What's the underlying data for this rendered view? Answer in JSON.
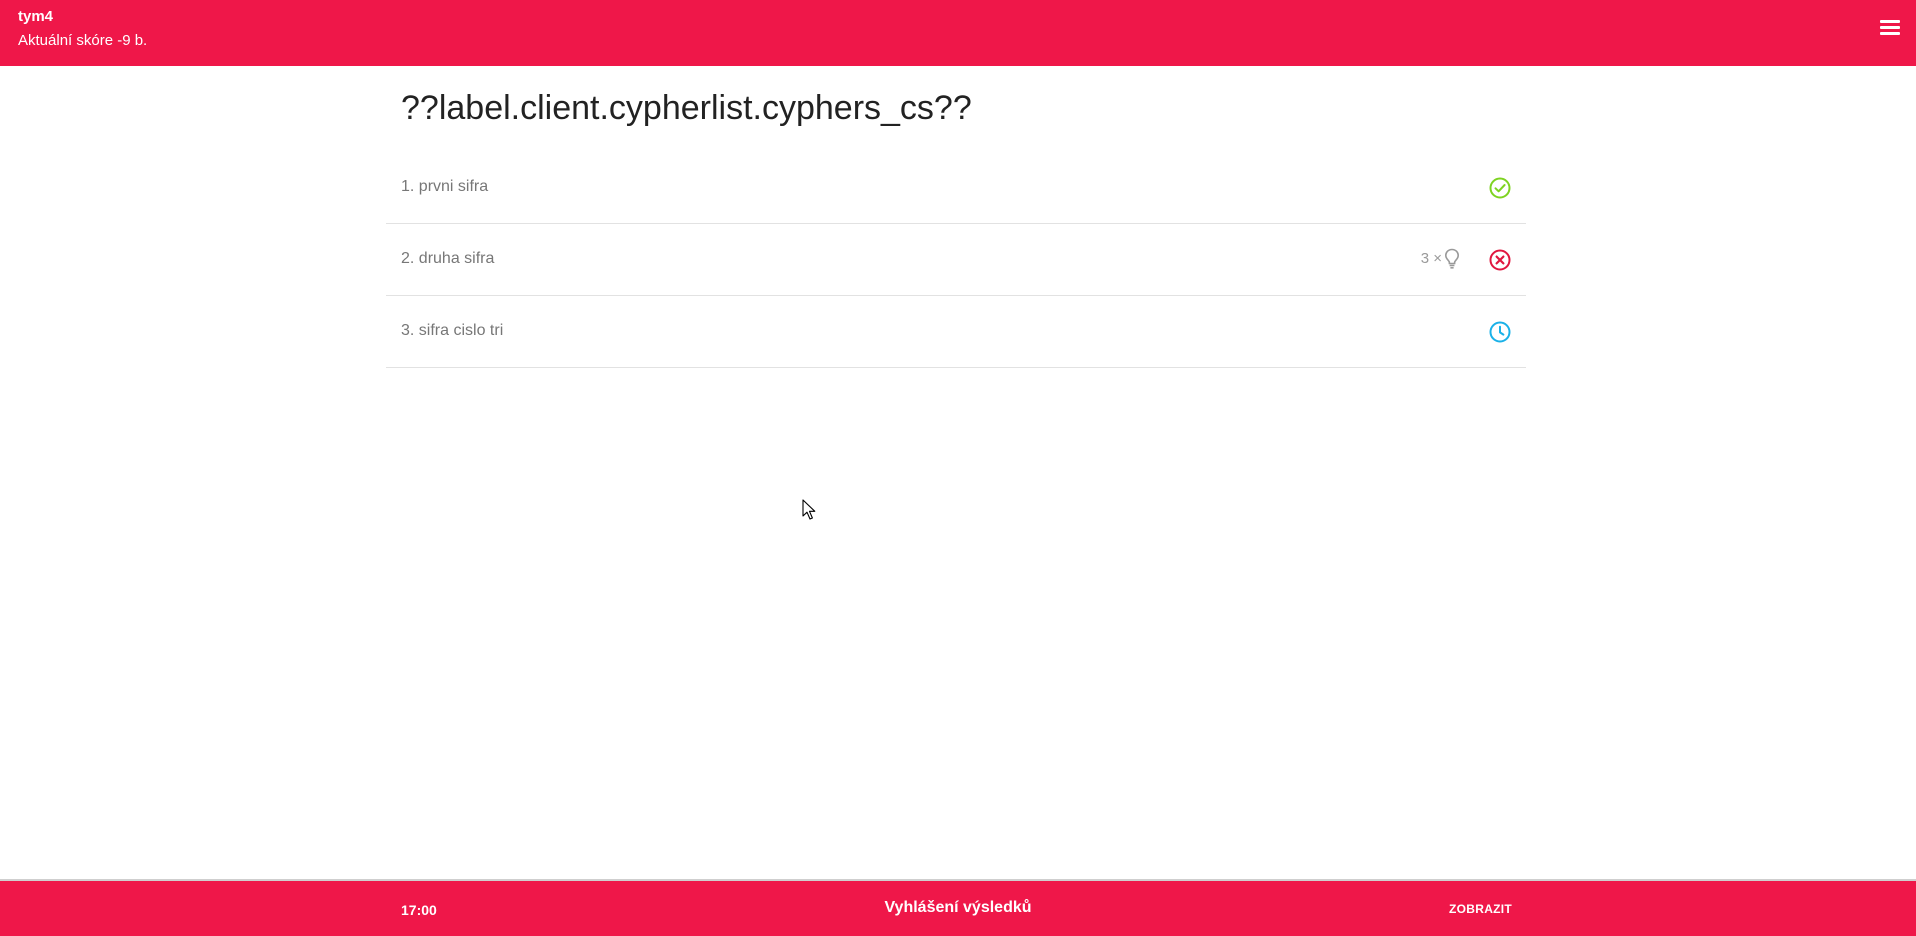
{
  "header": {
    "team_name": "tym4",
    "score_text": "Aktuální skóre -9 b.",
    "menu_icon": "hamburger-menu-icon",
    "background_color": "#ef1749"
  },
  "main": {
    "title": "??label.client.cypherlist.cyphers_cs??",
    "cyphers": [
      {
        "label": "1. prvni sifra",
        "status": "solved",
        "status_icon": "check-circle-icon",
        "status_color": "#7ed321"
      },
      {
        "label": "2. druha sifra",
        "status": "failed",
        "status_icon": "x-circle-icon",
        "status_color": "#e0173f",
        "hints_used": "3 ×",
        "hint_icon": "lightbulb-icon"
      },
      {
        "label": "3. sifra cislo tri",
        "status": "in-progress",
        "status_icon": "clock-icon",
        "status_color": "#1ab1e8"
      }
    ]
  },
  "footer": {
    "time": "17:00",
    "event_name": "Vyhlášení výsledků",
    "show_button_label": "ZOBRAZIT"
  }
}
